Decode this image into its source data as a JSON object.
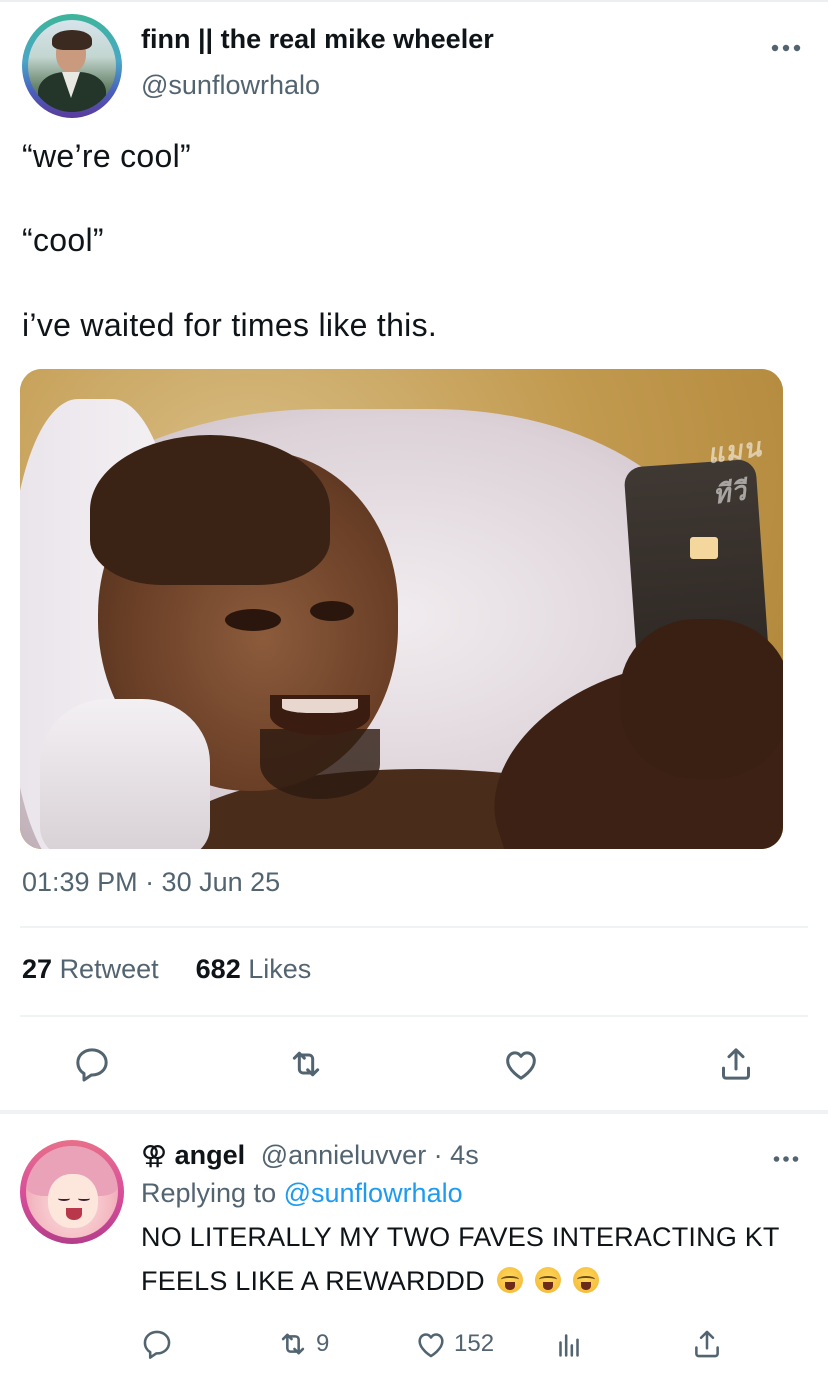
{
  "tweet": {
    "author_name": "finn || the real mike wheeler",
    "author_handle": "@sunflowrhalo",
    "lines": [
      "“we’re cool”",
      "“cool”",
      "i’ve waited for times like this."
    ],
    "media_watermark": "แมน ทีวี",
    "timestamp": "01:39 PM · 30 Jun 25",
    "stats": {
      "retweets": "27",
      "retweets_label": "Retweet",
      "likes": "682",
      "likes_label": "Likes"
    },
    "actions": [
      "reply-icon",
      "retweet-icon",
      "like-icon",
      "share-icon"
    ]
  },
  "reply": {
    "name_symbol": "⚢",
    "author_name": "angel",
    "author_handle": "@annieluvver · 4s",
    "replying_prefix": "Replying to",
    "replying_to": "@sunflowrhalo",
    "text_line1": "NO LITERALLY MY TWO FAVES INTERACTING KT",
    "text_line2": "FEELS LIKE A REWARDDD",
    "emoji_count": 3,
    "retweets": "9",
    "likes": "152",
    "actions": [
      "reply-icon",
      "retweet-icon",
      "like-icon",
      "views-icon",
      "share-icon"
    ]
  },
  "colors": {
    "text": "#0f1419",
    "secondary": "#536471",
    "link": "#1d9bf0",
    "divider": "#eff3f4"
  }
}
